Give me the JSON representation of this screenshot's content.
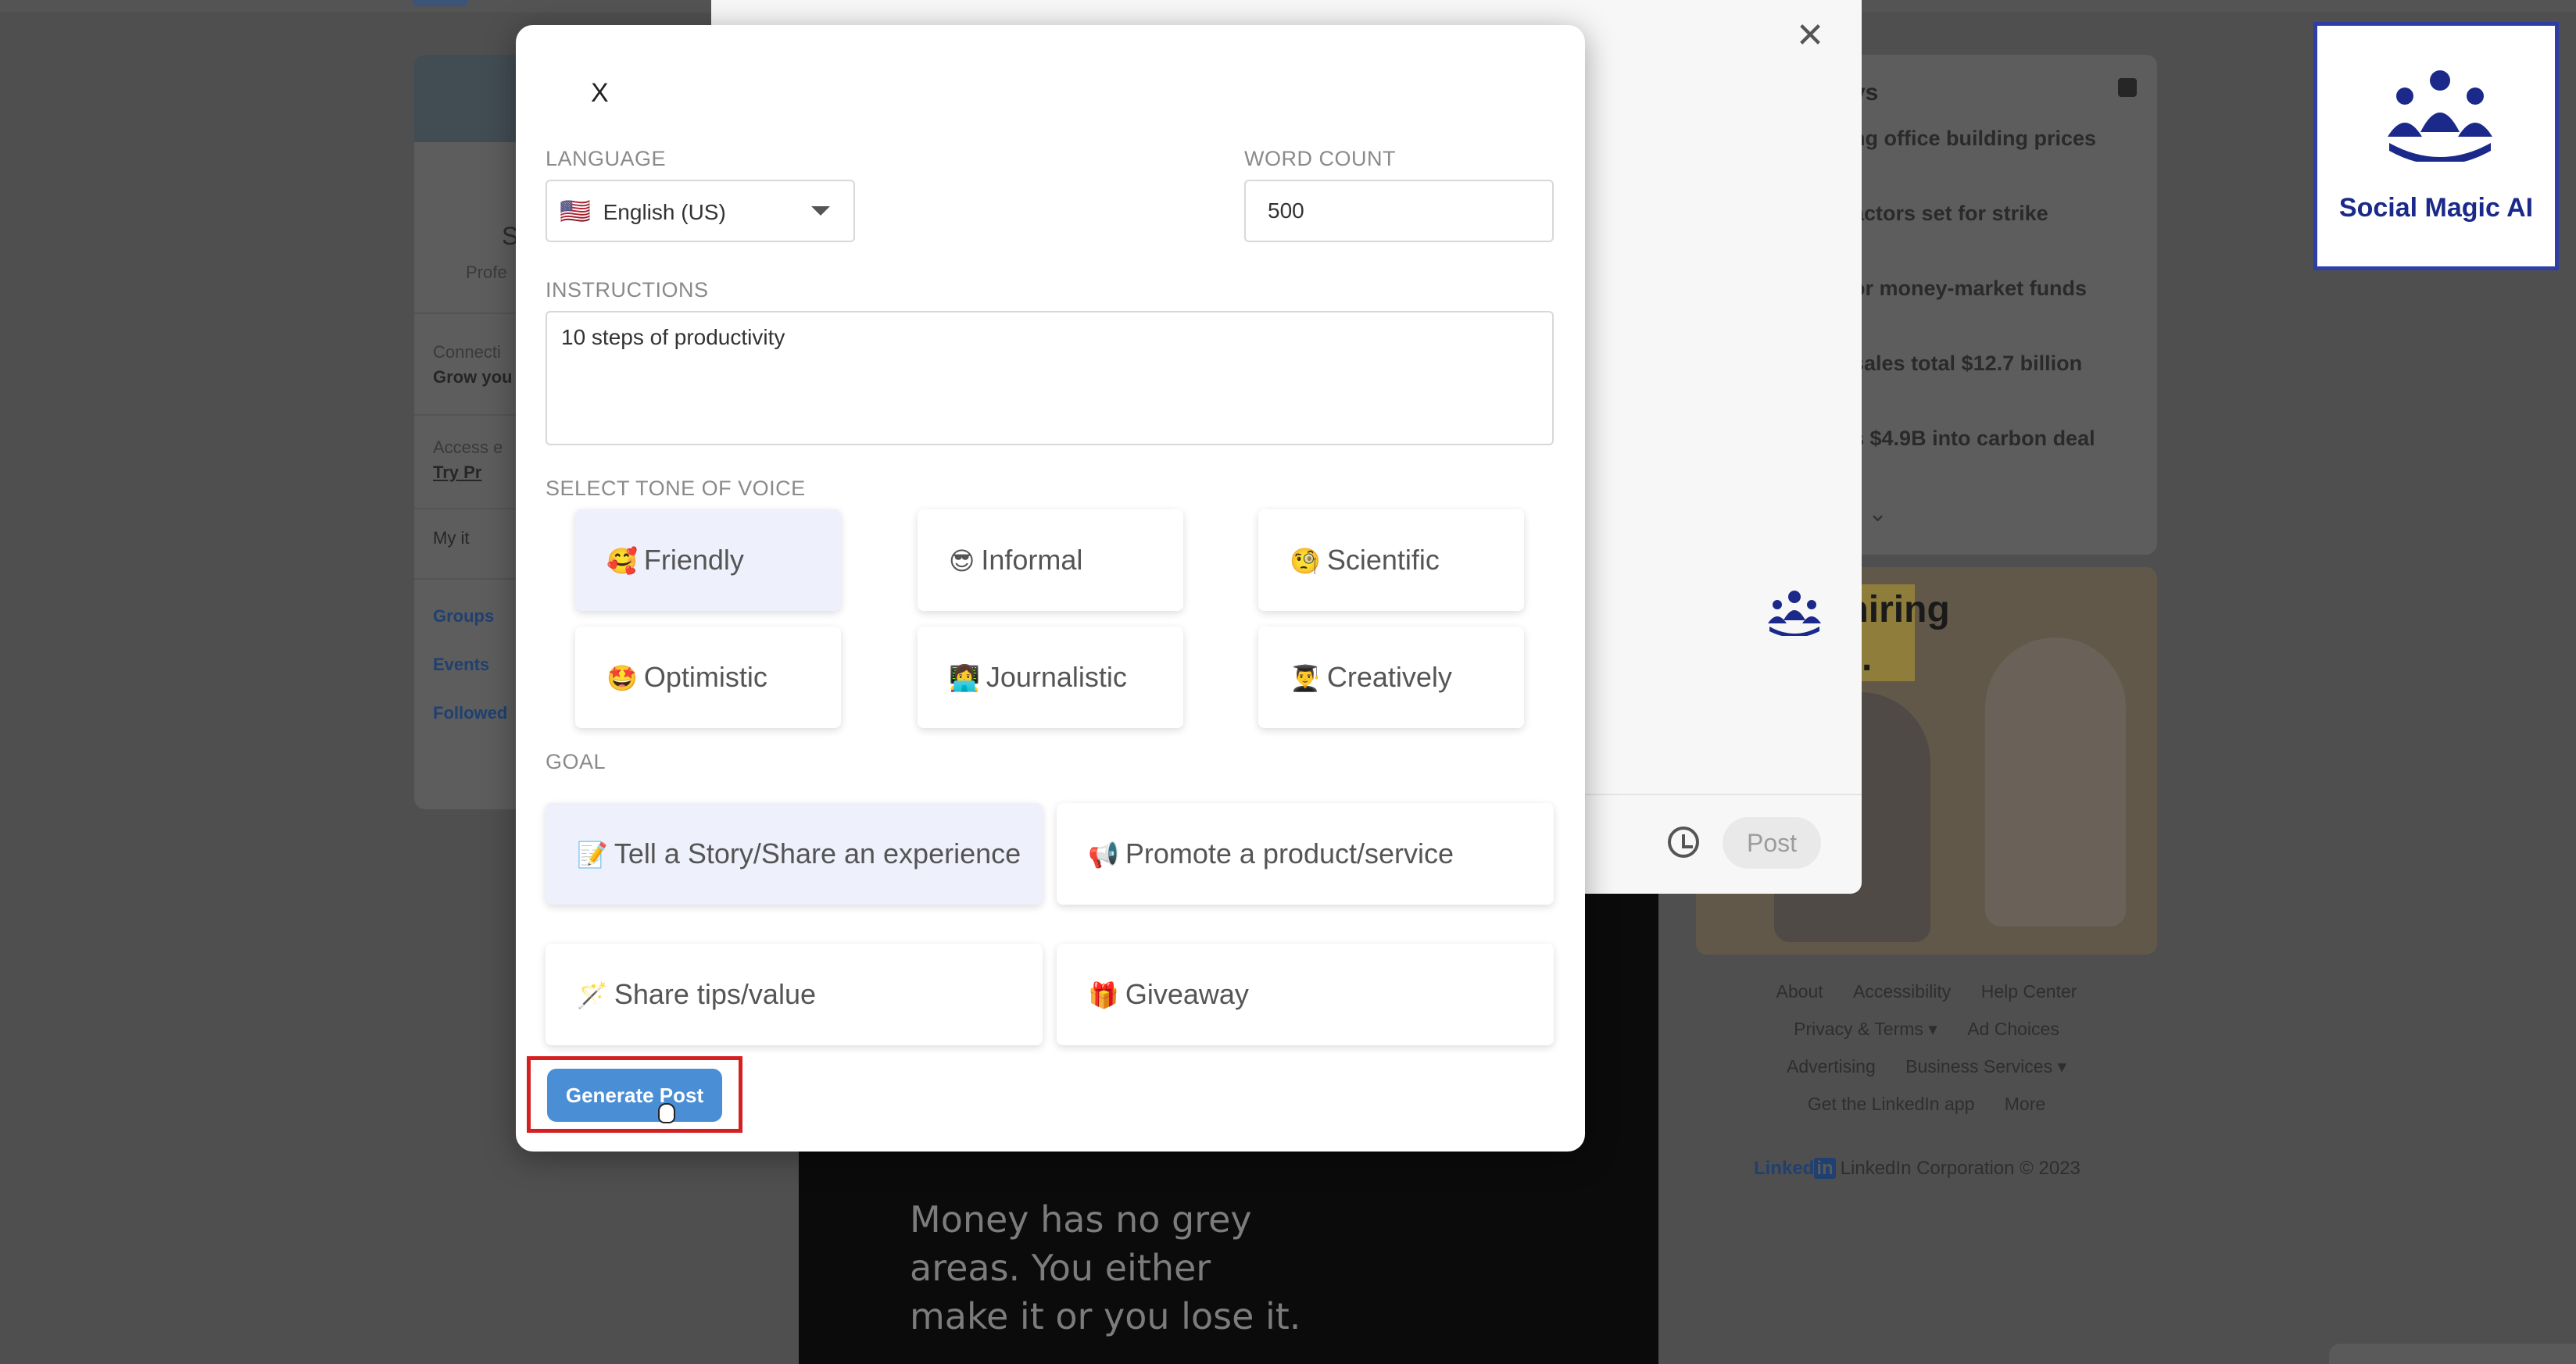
{
  "background": {
    "left_card": {
      "name_initial": "S",
      "profession_partial": "Profe",
      "connections_label": "Connecti",
      "connections_sub": "Grow you",
      "access_label": "Access e",
      "try_label": "Try Pr",
      "my_items": "My it",
      "nav": [
        "Groups",
        "Events",
        "Followed"
      ]
    },
    "news": {
      "title_partial": "vs",
      "items": [
        "ng office building prices",
        "actors set for strike",
        "or money-market funds",
        "sales total $12.7 billion",
        "s $4.9B into carbon deal"
      ]
    },
    "ad": {
      "text_line1": "'s hiring",
      "text_line2": "dln."
    },
    "footer": {
      "row1": [
        "About",
        "Accessibility",
        "Help Center"
      ],
      "row2": [
        "Privacy & Terms ▾",
        "Ad Choices"
      ],
      "row3": [
        "Advertising",
        "Business Services ▾"
      ],
      "row4": [
        "Get the LinkedIn app",
        "More"
      ],
      "brand": "Linked",
      "brand_in": "in",
      "copyright": "LinkedIn Corporation © 2023"
    },
    "feed_quote": "Money has no grey\nareas. You either\nmake it or you lose it."
  },
  "composer": {
    "post_label": "Post"
  },
  "modal": {
    "close_label": "X",
    "language_label": "LANGUAGE",
    "language_flag": "🇺🇸",
    "language_value": "English (US)",
    "word_count_label": "WORD COUNT",
    "word_count_value": "500",
    "instructions_label": "INSTRUCTIONS",
    "instructions_value": "10 steps of productivity",
    "tone_label": "SELECT TONE OF VOICE",
    "tones": [
      {
        "emoji": "🥰",
        "label": "Friendly",
        "selected": true
      },
      {
        "emoji": "😎",
        "label": "Informal",
        "selected": false
      },
      {
        "emoji": "🧐",
        "label": "Scientific",
        "selected": false
      },
      {
        "emoji": "🤩",
        "label": "Optimistic",
        "selected": false
      },
      {
        "emoji": "👩‍💻",
        "label": "Journalistic",
        "selected": false
      },
      {
        "emoji": "👨‍🎓",
        "label": "Creatively",
        "selected": false
      }
    ],
    "goal_label": "GOAL",
    "goals": [
      {
        "emoji": "📝",
        "label": "Tell a Story/Share an experience",
        "selected": true
      },
      {
        "emoji": "📢",
        "label": "Promote a product/service",
        "selected": false
      },
      {
        "emoji": "🪄",
        "label": "Share tips/value",
        "selected": false
      },
      {
        "emoji": "🎁",
        "label": "Giveaway",
        "selected": false
      }
    ],
    "generate_label": "Generate Post"
  },
  "logo": {
    "title": "Social Magic AI",
    "color": "#1b2a8a"
  }
}
